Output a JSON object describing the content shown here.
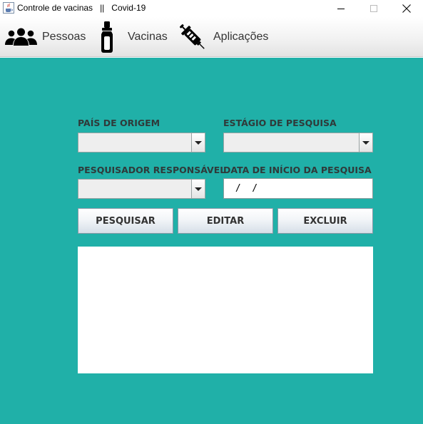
{
  "window": {
    "title": "Controle de vacinas   ||   Covid-19",
    "icon": "java-cup-icon",
    "controls": [
      "minimize-icon",
      "maximize-icon",
      "close-icon"
    ]
  },
  "toolbar": {
    "items": [
      {
        "label": "Pessoas",
        "icon": "people-icon"
      },
      {
        "label": "Vacinas",
        "icon": "vial-icon"
      },
      {
        "label": "Aplicações",
        "icon": "syringe-icon"
      }
    ]
  },
  "form": {
    "pais_label": "PAÍS DE ORIGEM",
    "pais_value": "",
    "estagio_label": "ESTÁGIO DE PESQUISA",
    "estagio_value": "",
    "pesquisador_label": "PESQUISADOR RESPONSÁVEL",
    "pesquisador_value": "",
    "data_label": "DATA DE INÍCIO DA PESQUISA",
    "data_value": " /  /"
  },
  "actions": {
    "pesquisar": "PESQUISAR",
    "editar": "EDITAR",
    "excluir": "EXCLUIR"
  },
  "colors": {
    "panel": "#20b0a8",
    "toolbar": "#f2f2f2",
    "label_text": "#2f3a3a"
  }
}
